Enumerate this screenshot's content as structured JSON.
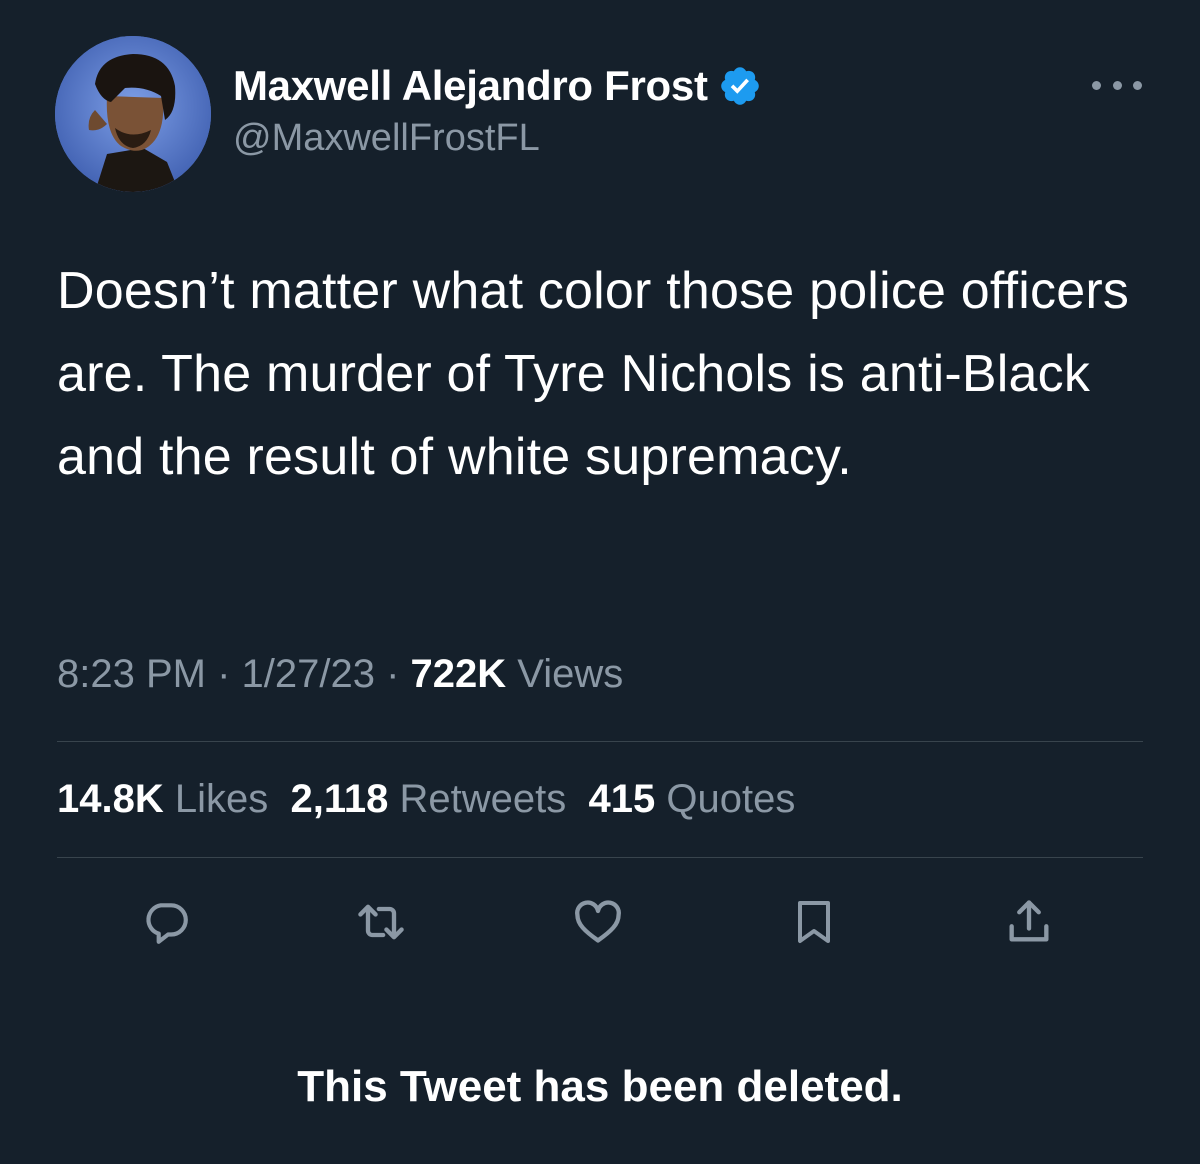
{
  "author": {
    "display_name": "Maxwell Alejandro Frost",
    "handle": "@MaxwellFrostFL",
    "verified": true
  },
  "tweet": {
    "text": "Doesn’t matter what color those police officers are. The murder of Tyre Nichols is anti-Black and the result of white supremacy.",
    "time": "8:23 PM",
    "date": "1/27/23",
    "separator": " · ",
    "views_count": "722K",
    "views_label": "Views"
  },
  "stats": {
    "likes_count": "14.8K",
    "likes_label": "Likes",
    "retweets_count": "2,118",
    "retweets_label": "Retweets",
    "quotes_count": "415",
    "quotes_label": "Quotes"
  },
  "actions": {
    "reply_icon": "reply-icon",
    "retweet_icon": "retweet-icon",
    "like_icon": "heart-icon",
    "bookmark_icon": "bookmark-icon",
    "share_icon": "share-icon"
  },
  "overlay": {
    "deleted_notice": "This Tweet has been deleted."
  },
  "colors": {
    "background": "#15202b",
    "secondary_text": "#8b98a5",
    "verified_badge": "#1d9bf0",
    "divider": "#38444d"
  }
}
